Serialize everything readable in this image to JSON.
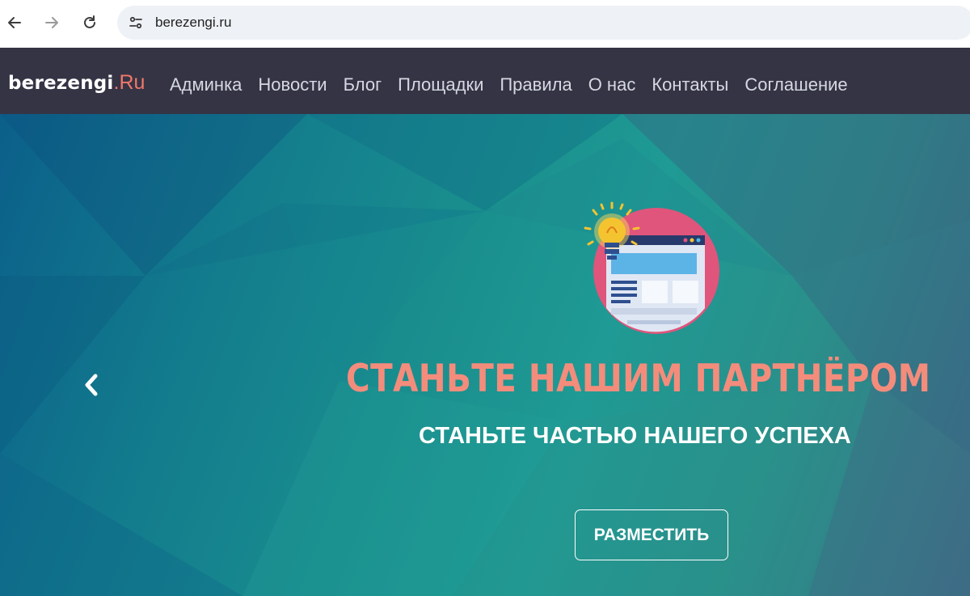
{
  "browser": {
    "url": "berezengi.ru",
    "icons": {
      "back": "arrow-left-icon",
      "forward": "arrow-right-icon",
      "reload": "reload-icon",
      "site_info": "tune-icon"
    }
  },
  "header": {
    "logo_main": "berezengi",
    "logo_tld": ".Ru",
    "menu": [
      {
        "label": "Админка"
      },
      {
        "label": "Новости"
      },
      {
        "label": "Блог"
      },
      {
        "label": "Площадки"
      },
      {
        "label": "Правила"
      },
      {
        "label": "О нас"
      },
      {
        "label": "Контакты"
      },
      {
        "label": "Соглашение"
      }
    ]
  },
  "hero": {
    "title": "СТАНЬТЕ НАШИМ ПАРТНЁРОМ",
    "subtitle": "СТАНЬТЕ ЧАСТЬЮ НАШЕГО УСПЕХА",
    "cta_label": "РАЗМЕСТИТЬ",
    "prev_icon": "chevron-left-icon",
    "illustration": "lightbulb-webpage-icon"
  },
  "colors": {
    "header_bg": "#353445",
    "logo_accent": "#f0786a",
    "title": "#f48c7c",
    "hero_teal": "#1f9a94",
    "hero_blue": "#0b5f8a"
  }
}
